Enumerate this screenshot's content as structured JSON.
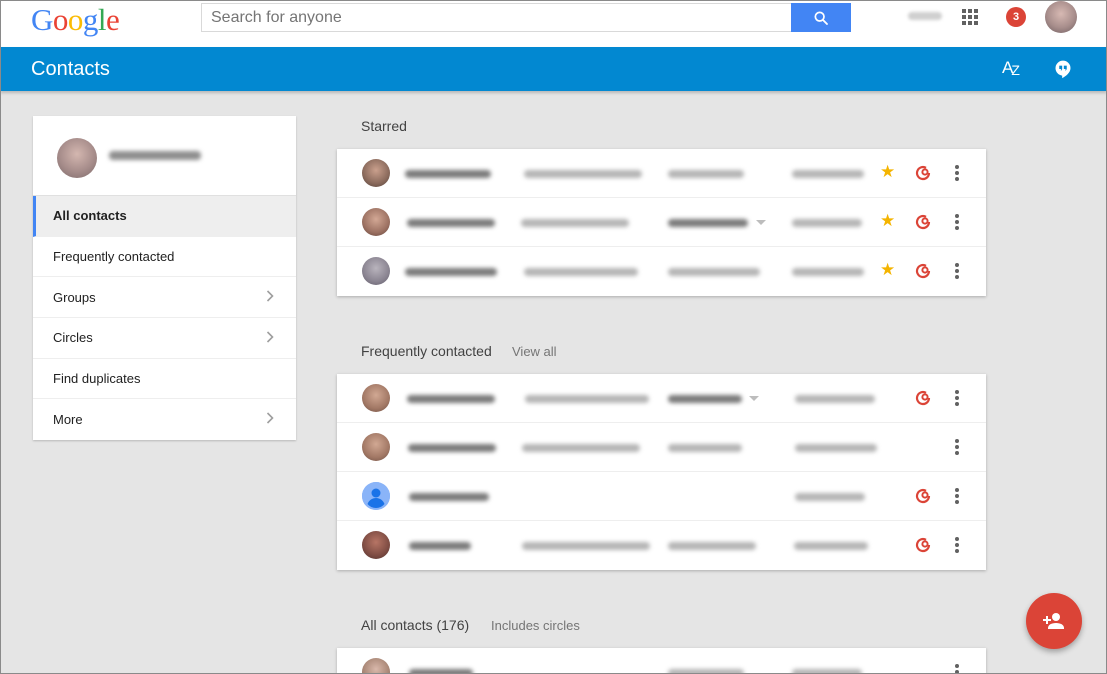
{
  "logo": "Google",
  "search": {
    "placeholder": "Search for anyone"
  },
  "notifications": {
    "count": "3"
  },
  "header": {
    "title": "Contacts",
    "sort_icon": "az-sort-icon",
    "hangouts_icon": "hangouts-icon"
  },
  "sidebar": {
    "items": [
      {
        "label": "All contacts",
        "active": true,
        "has_chevron": false
      },
      {
        "label": "Frequently contacted",
        "active": false,
        "has_chevron": false
      },
      {
        "label": "Groups",
        "active": false,
        "has_chevron": true
      },
      {
        "label": "Circles",
        "active": false,
        "has_chevron": true
      },
      {
        "label": "Find duplicates",
        "active": false,
        "has_chevron": false
      },
      {
        "label": "More",
        "active": false,
        "has_chevron": true
      }
    ]
  },
  "sections": {
    "starred": {
      "title": "Starred"
    },
    "frequent": {
      "title": "Frequently contacted",
      "link": "View all"
    },
    "all": {
      "title": "All contacts (176)",
      "subtitle": "Includes circles"
    }
  },
  "colors": {
    "header_blue": "#0288d1",
    "search_blue": "#4285f4",
    "accent_red": "#db4437",
    "star_yellow": "#f4b400"
  },
  "icons": [
    "search-icon",
    "apps-grid-icon",
    "az-sort-icon",
    "hangouts-icon",
    "chevron-right-icon",
    "star-icon",
    "google-plus-circle-icon",
    "more-vert-icon",
    "person-add-icon",
    "default-avatar-icon"
  ]
}
